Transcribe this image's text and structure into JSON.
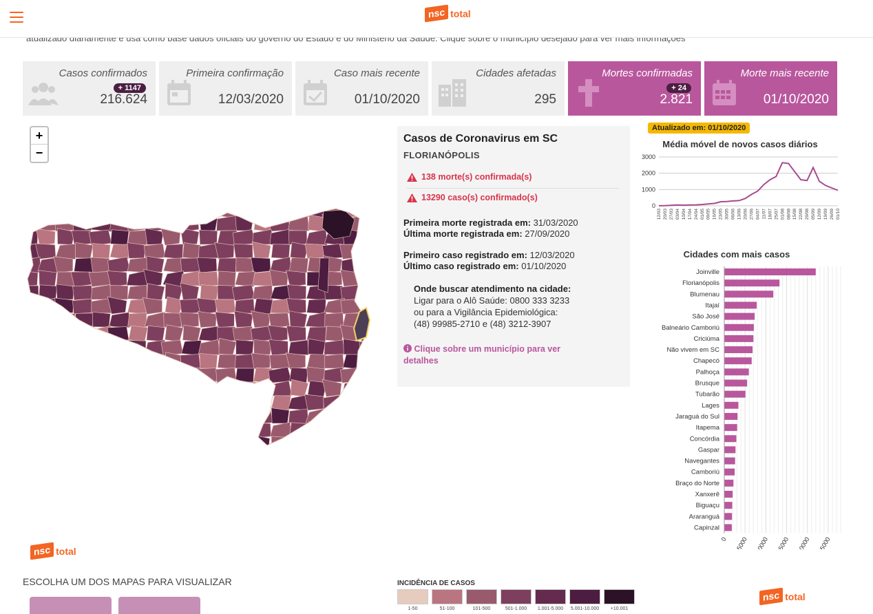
{
  "header": {
    "logo_badge": "nsc",
    "logo_word": "total"
  },
  "intro_text": "atualizado diariamente e usa como base dados oficiais do governo do Estado e do Ministério da Saúde. Clique sobre o município desejado para ver mais informações",
  "cards": [
    {
      "label": "Casos confirmados",
      "value": "216.624",
      "delta": "+ 1147",
      "icon": "people-icon",
      "style": "gray"
    },
    {
      "label": "Primeira confirmação",
      "value": "12/03/2020",
      "delta": "",
      "icon": "calendar-icon",
      "style": "gray"
    },
    {
      "label": "Caso mais recente",
      "value": "01/10/2020",
      "delta": "",
      "icon": "calendar-check-icon",
      "style": "gray"
    },
    {
      "label": "Cidades afetadas",
      "value": "295",
      "delta": "",
      "icon": "buildings-icon",
      "style": "gray"
    },
    {
      "label": "Mortes confirmadas",
      "value": "2.821",
      "delta": "+ 24",
      "icon": "cross-icon",
      "style": "pink"
    },
    {
      "label": "Morte mais recente",
      "value": "01/10/2020",
      "delta": "",
      "icon": "calendar-grid-icon",
      "style": "pink"
    }
  ],
  "zoom": {
    "in": "+",
    "out": "−"
  },
  "info": {
    "title": "Casos de Coronavirus em SC",
    "city": "FLORIANÓPOLIS",
    "deaths": "138 morte(s) confirmada(s)",
    "cases": "13290 caso(s) confirmado(s)",
    "first_death_label": "Primeira morte registrada em:",
    "first_death": "31/03/2020",
    "last_death_label": "Última morte registrada em:",
    "last_death": "27/09/2020",
    "first_case_label": "Primeiro caso registrado em:",
    "first_case": "12/03/2020",
    "last_case_label": "Último caso registrado em:",
    "last_case": "01/10/2020",
    "help_title": "Onde buscar atendimento na cidade:",
    "help_line1": "Ligar para o Alô Saúde: 0800 333 3233",
    "help_line2": "ou para a Vigilância Epidemiológica:",
    "help_line3": "(48) 99985-2710 e (48) 3212-3907",
    "hint": "Clique sobre um município para ver detalhes"
  },
  "updated_badge": "Atualizado em: 01/10/2020",
  "chart_data": [
    {
      "type": "line",
      "title": "Média móvel de novos casos diários",
      "x": [
        "12/03",
        "20/03",
        "27/03",
        "03/04",
        "10/04",
        "17/04",
        "24/04",
        "01/05",
        "09/05",
        "16/05",
        "23/05",
        "30/05",
        "06/06",
        "13/06",
        "20/06",
        "27/06",
        "04/07",
        "11/07",
        "18/07",
        "25/07",
        "01/08",
        "08/08",
        "15/08",
        "22/08",
        "29/08",
        "05/09",
        "12/09",
        "19/09",
        "26/09",
        "01/10"
      ],
      "values": [
        5,
        10,
        30,
        55,
        40,
        50,
        60,
        80,
        120,
        150,
        250,
        260,
        300,
        320,
        450,
        700,
        900,
        1300,
        1600,
        1800,
        2650,
        2600,
        2100,
        1600,
        1550,
        2350,
        1500,
        1250,
        1100,
        950
      ],
      "ylim": [
        0,
        3000
      ],
      "yticks": [
        0,
        1000,
        2000,
        3000
      ]
    },
    {
      "type": "bar",
      "orientation": "horizontal",
      "title": "Cidades com mais casos",
      "categories": [
        "Joinville",
        "Florianópolis",
        "Blumenau",
        "Itajaí",
        "São José",
        "Balneário Camboriú",
        "Criciúma",
        "Não vivem em SC",
        "Chapecó",
        "Palhoça",
        "Brusque",
        "Tubarão",
        "Lages",
        "Jaraguá do Sul",
        "Itapema",
        "Concórdia",
        "Gaspar",
        "Navegantes",
        "Camboriú",
        "Braço do Norte",
        "Xanxerê",
        "Biguaçu",
        "Araranguá",
        "Capinzal"
      ],
      "values": [
        22000,
        13290,
        11800,
        7800,
        7300,
        7100,
        7000,
        6800,
        6600,
        5900,
        5500,
        5100,
        3400,
        3200,
        3100,
        2900,
        2700,
        2600,
        2500,
        2200,
        2000,
        1900,
        1850,
        1800
      ],
      "xlim": [
        0,
        27000
      ],
      "xticks": [
        0,
        5000,
        10000,
        15000,
        20000,
        25000
      ]
    }
  ],
  "map_legend": {
    "title": "INCIDÊNCIA DE CASOS",
    "items": [
      {
        "label": "1-50",
        "color": "#e6cbbf"
      },
      {
        "label": "51-100",
        "color": "#b97580"
      },
      {
        "label": "101-500",
        "color": "#9a5a6e"
      },
      {
        "label": "501-1.000",
        "color": "#7e3f5e"
      },
      {
        "label": "1.001-5.000",
        "color": "#642b4e"
      },
      {
        "label": "5.001-10.000",
        "color": "#4c1d40"
      },
      {
        "label": "+10.001",
        "color": "#2b1226"
      }
    ]
  },
  "choose_text": "ESCOLHA UM DOS MAPAS PARA VISUALIZAR",
  "colors": {
    "accent": "#f26522",
    "pink": "#b9579d",
    "line": "#a64a8f"
  }
}
